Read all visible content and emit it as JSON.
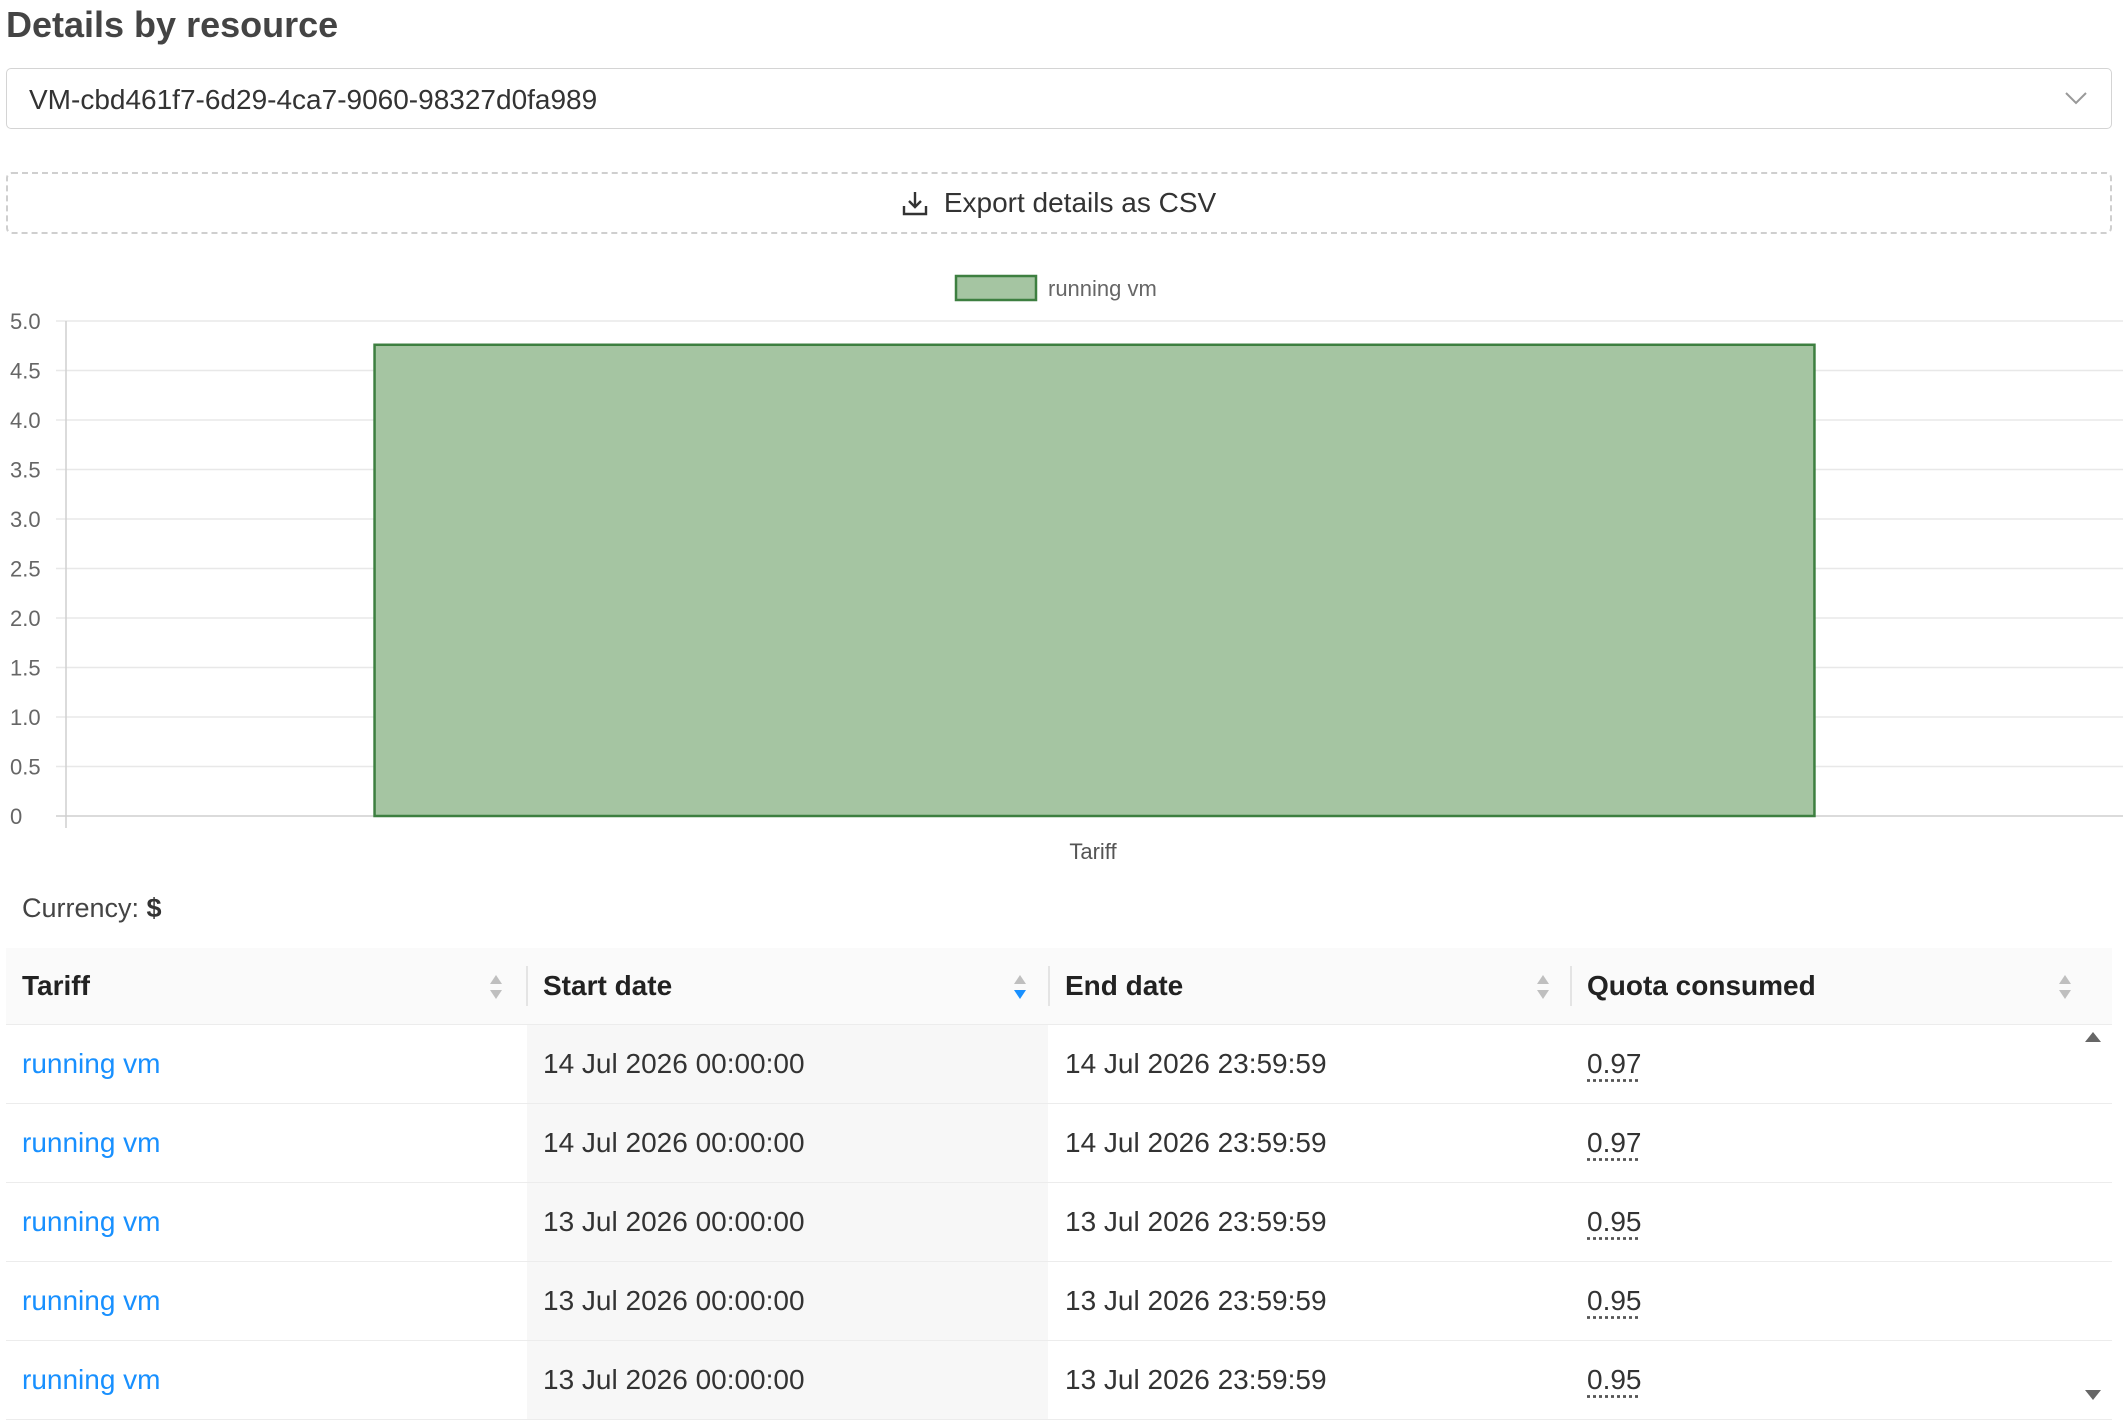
{
  "page": {
    "title": "Details by resource"
  },
  "resource_select": {
    "value": "VM-cbd461f7-6d29-4ca7-9060-98327d0fa989",
    "icon": "chevron-down-icon"
  },
  "export": {
    "label": "Export details as CSV",
    "icon": "download-icon"
  },
  "colors": {
    "bar_fill": "#a5c5a2",
    "bar_border": "#3d7f40",
    "link": "#1890ff",
    "sort_active": "#1890ff",
    "sort_inactive": "#bfbfbf"
  },
  "chart_data": {
    "type": "bar",
    "categories": [
      "Tariff"
    ],
    "series": [
      {
        "name": "running vm",
        "values": [
          4.76
        ]
      }
    ],
    "xlabel": "",
    "ylabel": "",
    "ylim": [
      0,
      5
    ],
    "yticks": [
      "0",
      "0.5",
      "1.0",
      "1.5",
      "2.0",
      "2.5",
      "3.0",
      "3.5",
      "4.0",
      "4.5",
      "5.0"
    ],
    "grid": true,
    "legend": "top-center"
  },
  "currency": {
    "label": "Currency:",
    "symbol": "$"
  },
  "table": {
    "columns": [
      "Tariff",
      "Start date",
      "End date",
      "Quota consumed"
    ],
    "sort": {
      "active_column": "Start date",
      "direction": "descending"
    },
    "rows": [
      {
        "tariff": "running vm",
        "start": "14 Jul 2026 00:00:00",
        "end": "14 Jul 2026 23:59:59",
        "quota": "0.97"
      },
      {
        "tariff": "running vm",
        "start": "14 Jul 2026 00:00:00",
        "end": "14 Jul 2026 23:59:59",
        "quota": "0.97"
      },
      {
        "tariff": "running vm",
        "start": "13 Jul 2026 00:00:00",
        "end": "13 Jul 2026 23:59:59",
        "quota": "0.95"
      },
      {
        "tariff": "running vm",
        "start": "13 Jul 2026 00:00:00",
        "end": "13 Jul 2026 23:59:59",
        "quota": "0.95"
      },
      {
        "tariff": "running vm",
        "start": "13 Jul 2026 00:00:00",
        "end": "13 Jul 2026 23:59:59",
        "quota": "0.95"
      }
    ]
  }
}
